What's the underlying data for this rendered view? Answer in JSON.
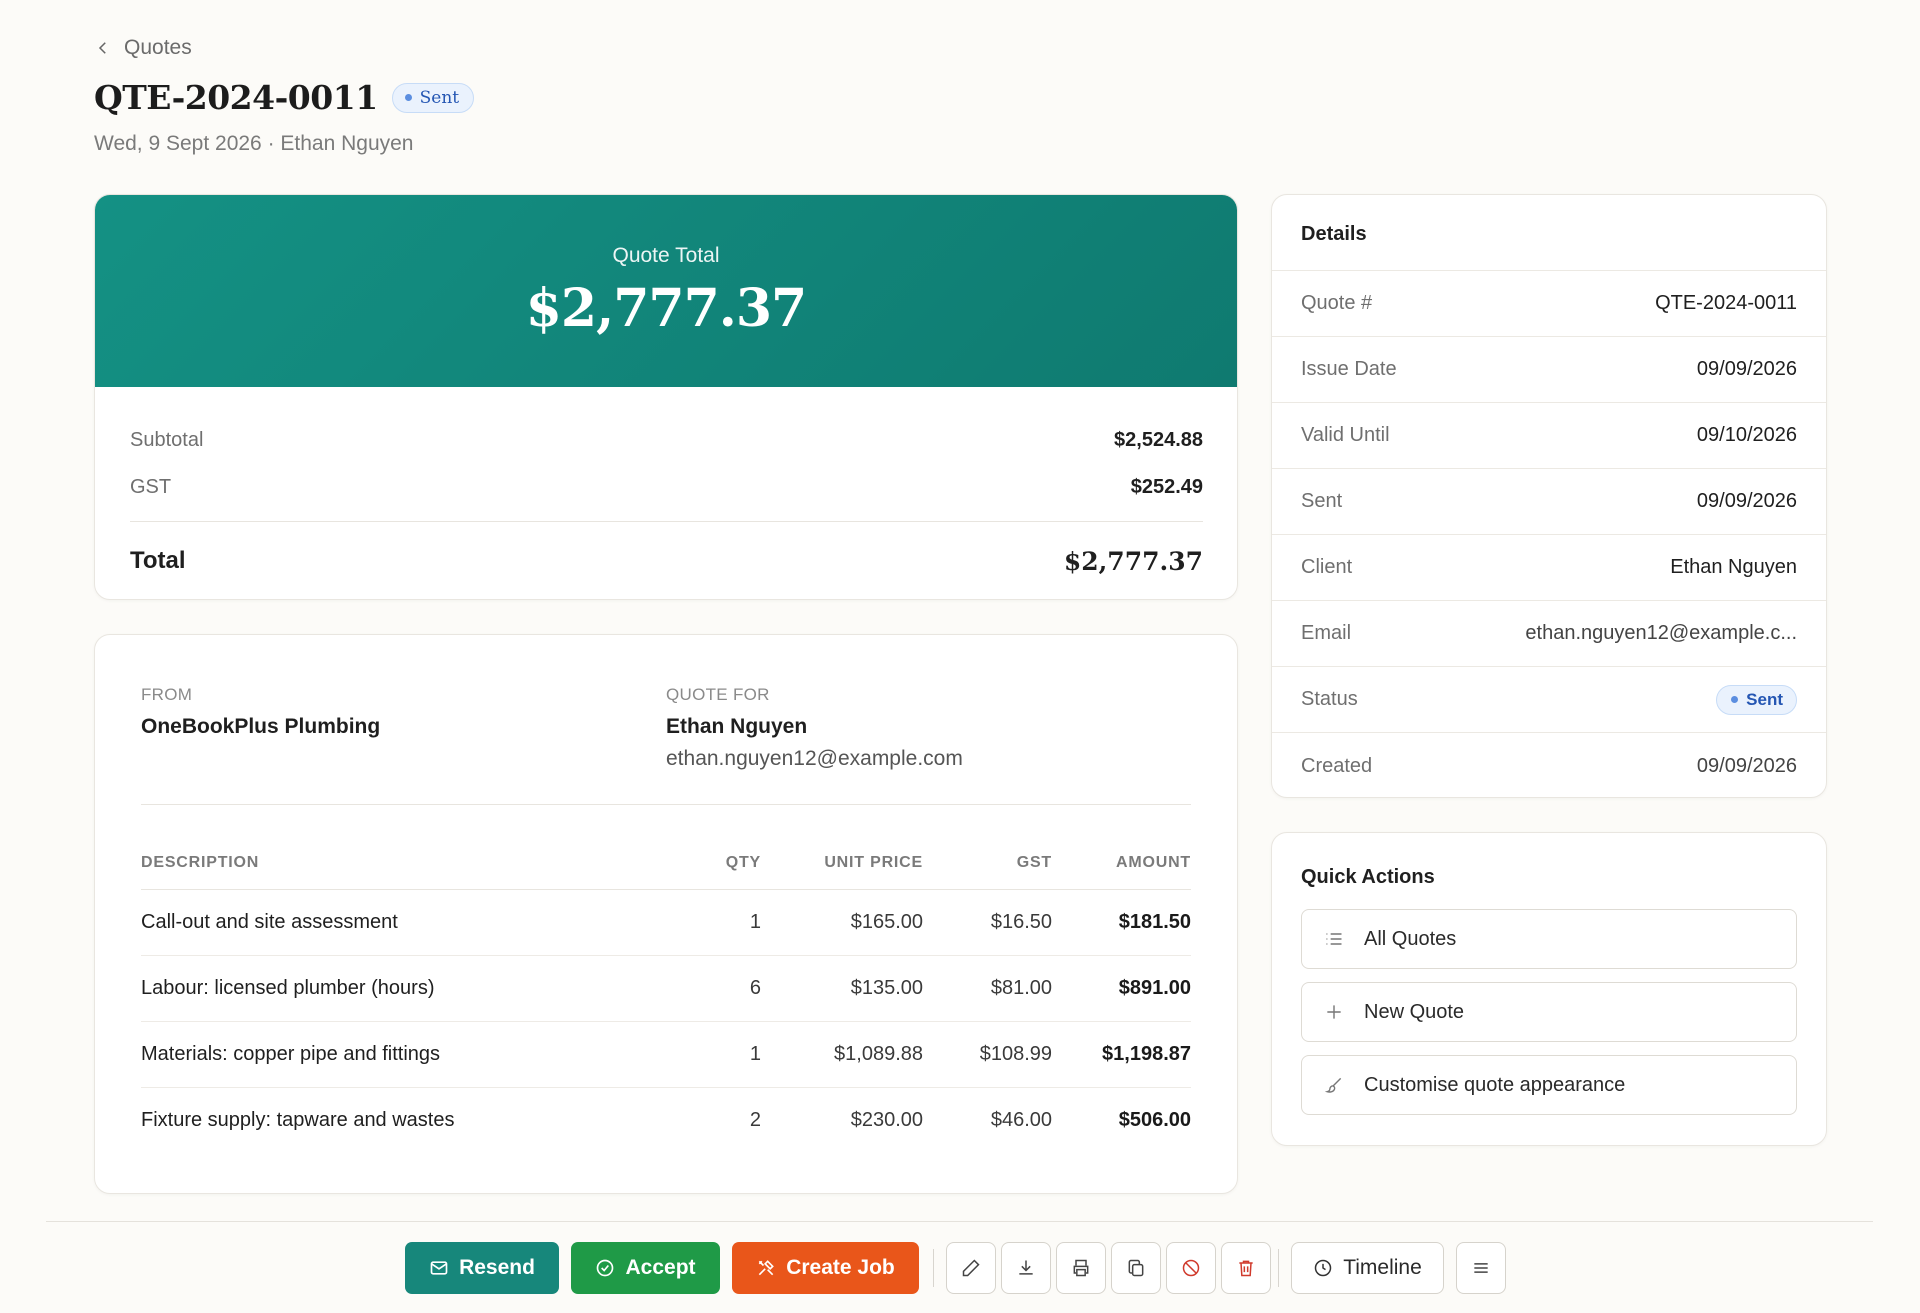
{
  "header": {
    "back_label": "Quotes",
    "title": "QTE-2024-0011",
    "status": "Sent",
    "subtitle": "Wed, 9 Sept 2026 · Ethan Nguyen"
  },
  "summary": {
    "hero_label": "Quote Total",
    "hero_amount": "$2,777.37",
    "subtotal_label": "Subtotal",
    "subtotal": "$2,524.88",
    "gst_label": "GST",
    "gst": "$252.49",
    "total_label": "Total",
    "total": "$2,777.37"
  },
  "document": {
    "from_label": "FROM",
    "from_name": "OneBookPlus Plumbing",
    "for_label": "QUOTE FOR",
    "for_name": "Ethan Nguyen",
    "for_email": "ethan.nguyen12@example.com",
    "columns": [
      "DESCRIPTION",
      "QTY",
      "UNIT PRICE",
      "GST",
      "AMOUNT"
    ],
    "items": [
      {
        "description": "Call-out and site assessment",
        "qty": "1",
        "unit_price": "$165.00",
        "gst": "$16.50",
        "amount": "$181.50"
      },
      {
        "description": "Labour: licensed plumber (hours)",
        "qty": "6",
        "unit_price": "$135.00",
        "gst": "$81.00",
        "amount": "$891.00"
      },
      {
        "description": "Materials: copper pipe and fittings",
        "qty": "1",
        "unit_price": "$1,089.88",
        "gst": "$108.99",
        "amount": "$1,198.87"
      },
      {
        "description": "Fixture supply: tapware and wastes",
        "qty": "2",
        "unit_price": "$230.00",
        "gst": "$46.00",
        "amount": "$506.00"
      }
    ]
  },
  "details": {
    "title": "Details",
    "rows": [
      {
        "label": "Quote #",
        "value": "QTE-2024-0011"
      },
      {
        "label": "Issue Date",
        "value": "09/09/2026"
      },
      {
        "label": "Valid Until",
        "value": "09/10/2026"
      },
      {
        "label": "Sent",
        "value": "09/09/2026"
      },
      {
        "label": "Client",
        "value": "Ethan Nguyen"
      },
      {
        "label": "Email",
        "value": "ethan.nguyen12@example.c..."
      },
      {
        "label": "Status",
        "value": "Sent"
      },
      {
        "label": "Created",
        "value": "09/09/2026"
      }
    ]
  },
  "quick_actions": {
    "title": "Quick Actions",
    "items": [
      {
        "label": "All Quotes",
        "icon": "list-icon"
      },
      {
        "label": "New Quote",
        "icon": "plus-icon"
      },
      {
        "label": "Customise quote appearance",
        "icon": "brush-icon"
      }
    ]
  },
  "toolbar": {
    "resend_label": "Resend",
    "accept_label": "Accept",
    "create_job_label": "Create Job",
    "timeline_label": "Timeline",
    "icons": [
      "edit-icon",
      "download-icon",
      "print-icon",
      "copy-icon",
      "cancel-icon",
      "trash-icon",
      "menu-icon"
    ]
  },
  "colors": {
    "teal": "#149184",
    "green": "#1f9a47",
    "orange": "#e9561a",
    "status_blue": "#2456b3",
    "danger": "#d03a2c"
  }
}
